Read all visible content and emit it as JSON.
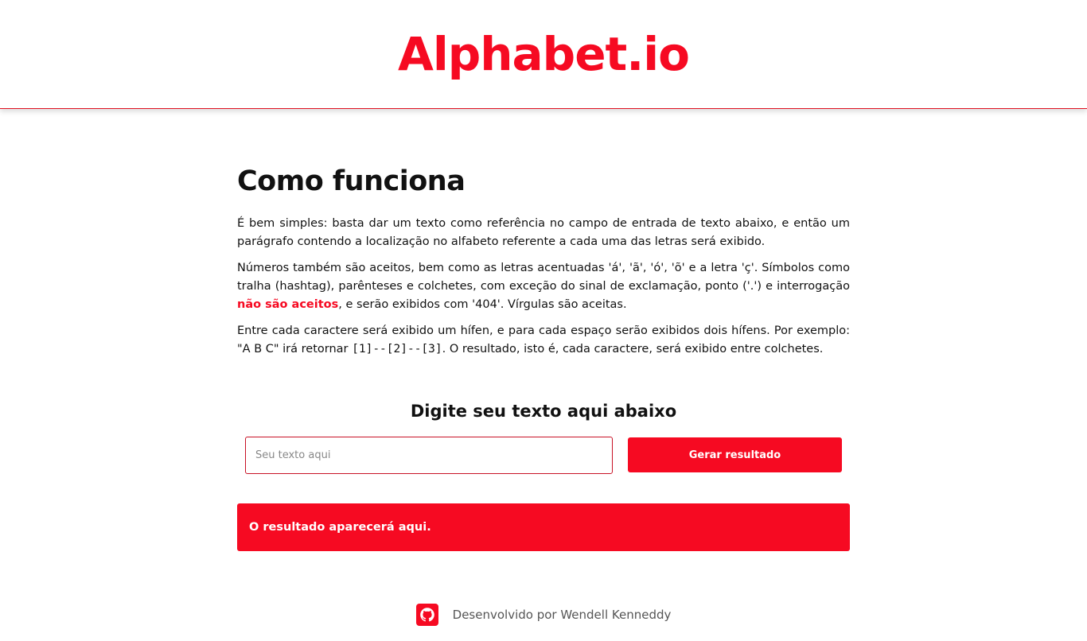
{
  "colors": {
    "accent": "#f60a22",
    "text": "#111111",
    "muted": "#555555"
  },
  "header": {
    "logo": "Alphabet.io"
  },
  "main": {
    "title": "Como funciona",
    "p1": "É bem simples: basta dar um texto como referência no campo de entrada de texto abaixo, e então um parágrafo contendo a localização no alfabeto referente a cada uma das letras será exibido.",
    "p2_a": "Números também são aceitos, bem como as letras acentuadas 'á', 'ã', 'ó', 'õ' e a letra 'ç'. Símbolos como tralha (hashtag), parênteses e colchetes, com exceção do sinal de exclamação, ponto ('.') e interrogação ",
    "p2_highlight": "não são aceitos",
    "p2_b": ", e serão exibidos com '404'. Vírgulas são aceitas.",
    "p3_a": "Entre cada caractere será exibido um hífen, e para cada espaço serão exibidos dois hífens. Por exemplo: \"A B C\" irá retornar ",
    "p3_code": "[1]--[2]--[3]",
    "p3_b": ". O resultado, isto é, cada caractere, será exibido entre colchetes."
  },
  "form": {
    "subtitle": "Digite seu texto aqui abaixo",
    "input_placeholder": "Seu texto aqui",
    "input_value": "",
    "button_label": "Gerar resultado"
  },
  "result": {
    "text": "O resultado aparecerá aqui."
  },
  "footer": {
    "icon": "github-icon",
    "text": "Desenvolvido por Wendell Kenneddy"
  }
}
